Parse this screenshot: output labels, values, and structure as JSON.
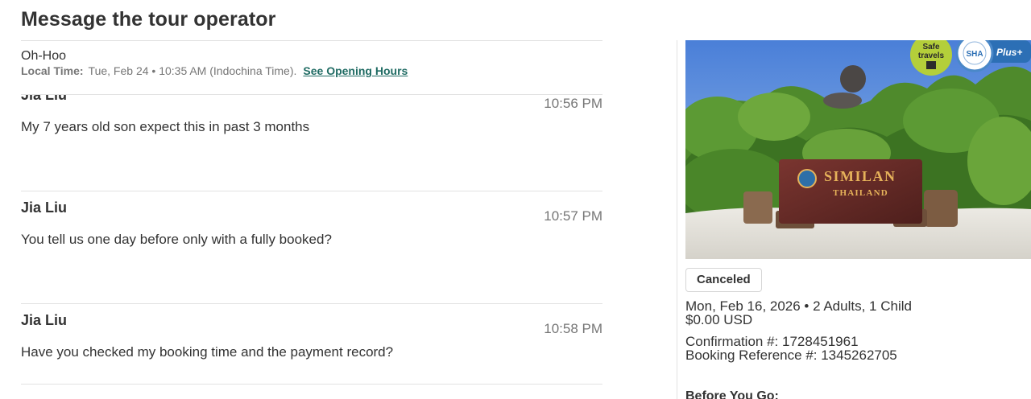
{
  "page": {
    "title": "Message the tour operator"
  },
  "operator": {
    "name": "Oh-Hoo",
    "local_time_label": "Local Time:",
    "local_time_value": "Tue, Feb 24 • 10:35 AM (Indochina Time).",
    "hours_link": "See Opening Hours"
  },
  "messages": [
    {
      "author": "Jia Liu",
      "time": "10:56 PM",
      "text": "My 7 years old son expect this in past 3 months"
    },
    {
      "author": "Jia Liu",
      "time": "10:57 PM",
      "text": "You tell us one day before only with a fully booked?"
    },
    {
      "author": "Jia Liu",
      "time": "10:58 PM",
      "text": "Have you checked my booking time and the payment record?"
    }
  ],
  "booking": {
    "status": "Canceled",
    "date_guests": "Mon, Feb 16, 2026 • 2 Adults, 1 Child",
    "price": "$0.00 USD",
    "confirmation": "Confirmation #: 1728451961",
    "reference": "Booking Reference #: 1345262705",
    "before_you_go": "Before You Go:"
  },
  "photo": {
    "sign_line1": "SIMILAN",
    "sign_line2": "THAILAND",
    "badge_safe": "Safe",
    "badge_travels": "travels",
    "badge_sha": "SHA",
    "badge_plus": "Plus+"
  },
  "colors": {
    "link": "#1f6b63",
    "muted": "#767676",
    "text": "#333333",
    "sign": "#e6b25a"
  },
  "icons": [
    "safe-travels-icon",
    "sha-seal-icon"
  ]
}
